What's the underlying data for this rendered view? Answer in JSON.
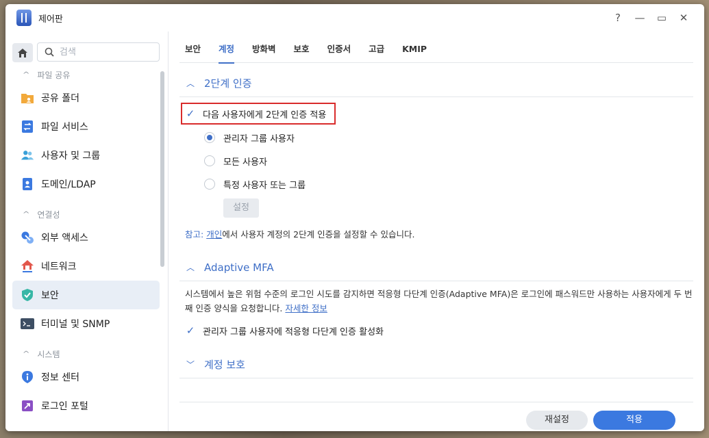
{
  "window": {
    "title": "제어판",
    "controls": {
      "help": "?",
      "minimize": "—",
      "maximize": "▭",
      "close": "✕"
    }
  },
  "sidebar": {
    "search_placeholder": "검색",
    "sections": [
      {
        "label": "파일 공유",
        "items": [
          {
            "label": "공유 폴더",
            "icon": "folder-icon"
          },
          {
            "label": "파일 서비스",
            "icon": "file-services-icon"
          },
          {
            "label": "사용자 및 그룹",
            "icon": "users-icon"
          },
          {
            "label": "도메인/LDAP",
            "icon": "domain-icon"
          }
        ]
      },
      {
        "label": "연결성",
        "items": [
          {
            "label": "외부 액세스",
            "icon": "external-access-icon"
          },
          {
            "label": "네트워크",
            "icon": "network-icon"
          },
          {
            "label": "보안",
            "icon": "shield-icon",
            "active": true
          },
          {
            "label": "터미널 및 SNMP",
            "icon": "terminal-icon"
          }
        ]
      },
      {
        "label": "시스템",
        "items": [
          {
            "label": "정보 센터",
            "icon": "info-icon"
          },
          {
            "label": "로그인 포털",
            "icon": "login-portal-icon"
          }
        ]
      }
    ]
  },
  "tabs": [
    "보안",
    "계정",
    "방화벽",
    "보호",
    "인증서",
    "고급",
    "KMIP"
  ],
  "active_tab": "계정",
  "two_factor": {
    "title": "2단계 인증",
    "enforce_label": "다음 사용자에게 2단계 인증 적용",
    "enforce_checked": true,
    "options": [
      "관리자 그룹 사용자",
      "모든 사용자",
      "특정 사용자 또는 그룹"
    ],
    "selected_option": 0,
    "settings_button": "설정",
    "note_label": "참고:",
    "note_link": "개인",
    "note_text": "에서 사용자 계정의 2단계 인증을 설정할 수 있습니다."
  },
  "adaptive_mfa": {
    "title": "Adaptive MFA",
    "description": "시스템에서 높은 위험 수준의 로그인 시도를 감지하면 적응형 다단계 인증(Adaptive MFA)은 로그인에 패스워드만 사용하는 사용자에게 두 번째 인증 양식을 요청합니다.",
    "learn_more": "자세한 정보",
    "enable_label": "관리자 그룹 사용자에 적응형 다단계 인증 활성화",
    "enable_checked": true
  },
  "account_protection": {
    "title": "계정 보호"
  },
  "footer": {
    "reset": "재설정",
    "apply": "적용"
  },
  "colors": {
    "accent": "#3f6fc7",
    "apply_button": "#3b79e0",
    "highlight": "#d92b2b"
  }
}
